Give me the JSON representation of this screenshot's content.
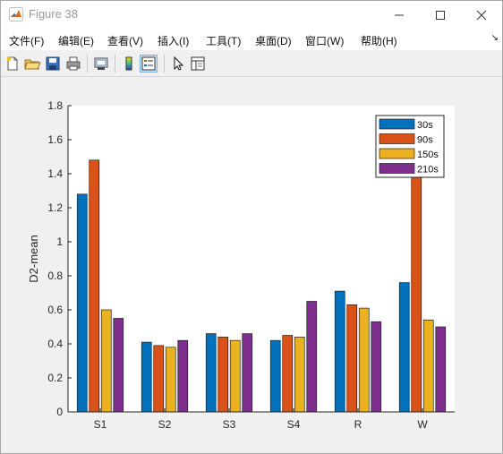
{
  "window": {
    "title": "Figure 38"
  },
  "menu": [
    {
      "label": "文件(F)"
    },
    {
      "label": "编辑(E)"
    },
    {
      "label": "查看(V)"
    },
    {
      "label": "插入(I)"
    },
    {
      "label": "工具(T)"
    },
    {
      "label": "桌面(D)"
    },
    {
      "label": "窗口(W)"
    },
    {
      "label": "帮助(H)"
    }
  ],
  "toolbar": {
    "icons": [
      "new-figure-icon",
      "open-file-icon",
      "save-icon",
      "print-icon",
      "link-plot-icon",
      "colorbar-icon",
      "legend-icon",
      "pointer-icon",
      "property-inspector-icon"
    ]
  },
  "colors": {
    "30s": "#0072BD",
    "90s": "#D95319",
    "150s": "#EDB120",
    "210s": "#7E2F8E"
  },
  "chart_data": {
    "type": "bar",
    "categories": [
      "S1",
      "S2",
      "S3",
      "S4",
      "R",
      "W"
    ],
    "series": [
      {
        "name": "30s",
        "values": [
          1.28,
          0.41,
          0.46,
          0.42,
          0.71,
          0.76
        ],
        "color": "#0072BD"
      },
      {
        "name": "90s",
        "values": [
          1.48,
          0.39,
          0.44,
          0.45,
          0.63,
          1.62
        ],
        "color": "#D95319"
      },
      {
        "name": "150s",
        "values": [
          0.6,
          0.38,
          0.42,
          0.44,
          0.61,
          0.54
        ],
        "color": "#EDB120"
      },
      {
        "name": "210s",
        "values": [
          0.55,
          0.42,
          0.46,
          0.65,
          0.53,
          0.5
        ],
        "color": "#7E2F8E"
      }
    ],
    "xlabel": "",
    "ylabel": "D2-mean",
    "ylim": [
      0,
      1.8
    ],
    "yticks": [
      "0",
      "0.2",
      "0.4",
      "0.6",
      "0.8",
      "1",
      "1.2",
      "1.4",
      "1.6",
      "1.8"
    ],
    "grid": false,
    "legend_position": "top-right"
  }
}
